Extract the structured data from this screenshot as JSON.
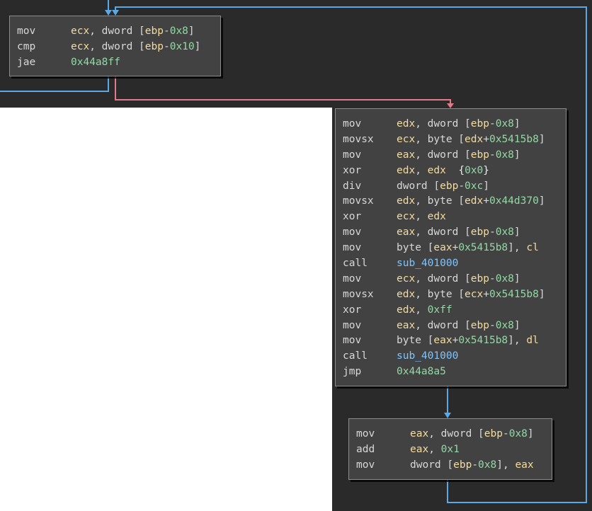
{
  "colors": {
    "background": "#2a2a2a",
    "block_bg": "#424242",
    "register": "#f3dca0",
    "number": "#93d9a6",
    "symbol": "#7ec5ff",
    "edge_true": "#e07b8a",
    "edge_flow": "#5aa9e6"
  },
  "blocks": [
    {
      "id": "loop-header",
      "lines": [
        {
          "mnemonic": "mov",
          "operands": [
            {
              "t": "ecx",
              "k": "reg"
            },
            {
              "t": ", dword [",
              "k": "plain"
            },
            {
              "t": "ebp",
              "k": "reg"
            },
            {
              "t": "-",
              "k": "plain"
            },
            {
              "t": "0x8",
              "k": "num"
            },
            {
              "t": "]",
              "k": "plain"
            }
          ]
        },
        {
          "mnemonic": "cmp",
          "operands": [
            {
              "t": "ecx",
              "k": "reg"
            },
            {
              "t": ", dword [",
              "k": "plain"
            },
            {
              "t": "ebp",
              "k": "reg"
            },
            {
              "t": "-",
              "k": "plain"
            },
            {
              "t": "0x10",
              "k": "num"
            },
            {
              "t": "]",
              "k": "plain"
            }
          ]
        },
        {
          "mnemonic": "jae",
          "operands": [
            {
              "t": "0x44a8ff",
              "k": "num"
            }
          ]
        }
      ]
    },
    {
      "id": "loop-body",
      "lines": [
        {
          "mnemonic": "mov",
          "operands": [
            {
              "t": "edx",
              "k": "reg"
            },
            {
              "t": ", dword [",
              "k": "plain"
            },
            {
              "t": "ebp",
              "k": "reg"
            },
            {
              "t": "-",
              "k": "plain"
            },
            {
              "t": "0x8",
              "k": "num"
            },
            {
              "t": "]",
              "k": "plain"
            }
          ]
        },
        {
          "mnemonic": "movsx",
          "operands": [
            {
              "t": "ecx",
              "k": "reg"
            },
            {
              "t": ", byte [",
              "k": "plain"
            },
            {
              "t": "edx",
              "k": "reg"
            },
            {
              "t": "+",
              "k": "plain"
            },
            {
              "t": "0x5415b8",
              "k": "num"
            },
            {
              "t": "]",
              "k": "plain"
            }
          ]
        },
        {
          "mnemonic": "mov",
          "operands": [
            {
              "t": "eax",
              "k": "reg"
            },
            {
              "t": ", dword [",
              "k": "plain"
            },
            {
              "t": "ebp",
              "k": "reg"
            },
            {
              "t": "-",
              "k": "plain"
            },
            {
              "t": "0x8",
              "k": "num"
            },
            {
              "t": "]",
              "k": "plain"
            }
          ]
        },
        {
          "mnemonic": "xor",
          "operands": [
            {
              "t": "edx",
              "k": "reg"
            },
            {
              "t": ", ",
              "k": "plain"
            },
            {
              "t": "edx",
              "k": "reg"
            },
            {
              "t": "  {",
              "k": "com"
            },
            {
              "t": "0x0",
              "k": "num"
            },
            {
              "t": "}",
              "k": "com"
            }
          ]
        },
        {
          "mnemonic": "div",
          "operands": [
            {
              "t": "dword [",
              "k": "plain"
            },
            {
              "t": "ebp",
              "k": "reg"
            },
            {
              "t": "-",
              "k": "plain"
            },
            {
              "t": "0xc",
              "k": "num"
            },
            {
              "t": "]",
              "k": "plain"
            }
          ]
        },
        {
          "mnemonic": "movsx",
          "operands": [
            {
              "t": "edx",
              "k": "reg"
            },
            {
              "t": ", byte [",
              "k": "plain"
            },
            {
              "t": "edx",
              "k": "reg"
            },
            {
              "t": "+",
              "k": "plain"
            },
            {
              "t": "0x44d370",
              "k": "num"
            },
            {
              "t": "]",
              "k": "plain"
            }
          ]
        },
        {
          "mnemonic": "xor",
          "operands": [
            {
              "t": "ecx",
              "k": "reg"
            },
            {
              "t": ", ",
              "k": "plain"
            },
            {
              "t": "edx",
              "k": "reg"
            }
          ]
        },
        {
          "mnemonic": "mov",
          "operands": [
            {
              "t": "eax",
              "k": "reg"
            },
            {
              "t": ", dword [",
              "k": "plain"
            },
            {
              "t": "ebp",
              "k": "reg"
            },
            {
              "t": "-",
              "k": "plain"
            },
            {
              "t": "0x8",
              "k": "num"
            },
            {
              "t": "]",
              "k": "plain"
            }
          ]
        },
        {
          "mnemonic": "mov",
          "operands": [
            {
              "t": "byte [",
              "k": "plain"
            },
            {
              "t": "eax",
              "k": "reg"
            },
            {
              "t": "+",
              "k": "plain"
            },
            {
              "t": "0x5415b8",
              "k": "num"
            },
            {
              "t": "], ",
              "k": "plain"
            },
            {
              "t": "cl",
              "k": "reg"
            }
          ]
        },
        {
          "mnemonic": "call",
          "operands": [
            {
              "t": "sub_401000",
              "k": "sym"
            }
          ]
        },
        {
          "mnemonic": "mov",
          "operands": [
            {
              "t": "ecx",
              "k": "reg"
            },
            {
              "t": ", dword [",
              "k": "plain"
            },
            {
              "t": "ebp",
              "k": "reg"
            },
            {
              "t": "-",
              "k": "plain"
            },
            {
              "t": "0x8",
              "k": "num"
            },
            {
              "t": "]",
              "k": "plain"
            }
          ]
        },
        {
          "mnemonic": "movsx",
          "operands": [
            {
              "t": "edx",
              "k": "reg"
            },
            {
              "t": ", byte [",
              "k": "plain"
            },
            {
              "t": "ecx",
              "k": "reg"
            },
            {
              "t": "+",
              "k": "plain"
            },
            {
              "t": "0x5415b8",
              "k": "num"
            },
            {
              "t": "]",
              "k": "plain"
            }
          ]
        },
        {
          "mnemonic": "xor",
          "operands": [
            {
              "t": "edx",
              "k": "reg"
            },
            {
              "t": ", ",
              "k": "plain"
            },
            {
              "t": "0xff",
              "k": "num"
            }
          ]
        },
        {
          "mnemonic": "mov",
          "operands": [
            {
              "t": "eax",
              "k": "reg"
            },
            {
              "t": ", dword [",
              "k": "plain"
            },
            {
              "t": "ebp",
              "k": "reg"
            },
            {
              "t": "-",
              "k": "plain"
            },
            {
              "t": "0x8",
              "k": "num"
            },
            {
              "t": "]",
              "k": "plain"
            }
          ]
        },
        {
          "mnemonic": "mov",
          "operands": [
            {
              "t": "byte [",
              "k": "plain"
            },
            {
              "t": "eax",
              "k": "reg"
            },
            {
              "t": "+",
              "k": "plain"
            },
            {
              "t": "0x5415b8",
              "k": "num"
            },
            {
              "t": "], ",
              "k": "plain"
            },
            {
              "t": "dl",
              "k": "reg"
            }
          ]
        },
        {
          "mnemonic": "call",
          "operands": [
            {
              "t": "sub_401000",
              "k": "sym"
            }
          ]
        },
        {
          "mnemonic": "jmp",
          "operands": [
            {
              "t": "0x44a8a5",
              "k": "num"
            }
          ]
        }
      ]
    },
    {
      "id": "loop-increment",
      "lines": [
        {
          "mnemonic": "mov",
          "operands": [
            {
              "t": "eax",
              "k": "reg"
            },
            {
              "t": ", dword [",
              "k": "plain"
            },
            {
              "t": "ebp",
              "k": "reg"
            },
            {
              "t": "-",
              "k": "plain"
            },
            {
              "t": "0x8",
              "k": "num"
            },
            {
              "t": "]",
              "k": "plain"
            }
          ]
        },
        {
          "mnemonic": "add",
          "operands": [
            {
              "t": "eax",
              "k": "reg"
            },
            {
              "t": ", ",
              "k": "plain"
            },
            {
              "t": "0x1",
              "k": "num"
            }
          ]
        },
        {
          "mnemonic": "mov",
          "operands": [
            {
              "t": "dword [",
              "k": "plain"
            },
            {
              "t": "ebp",
              "k": "reg"
            },
            {
              "t": "-",
              "k": "plain"
            },
            {
              "t": "0x8",
              "k": "num"
            },
            {
              "t": "], ",
              "k": "plain"
            },
            {
              "t": "eax",
              "k": "reg"
            }
          ]
        }
      ]
    }
  ]
}
